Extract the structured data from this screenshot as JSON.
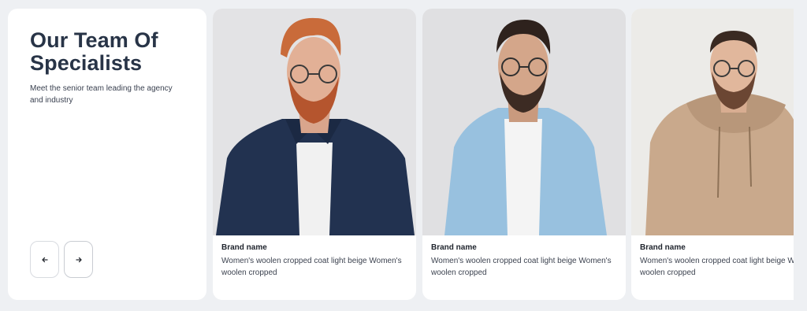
{
  "intro": {
    "title": "Our Team Of Specialists",
    "subtitle": "Meet the senior team leading the agency and industry"
  },
  "navigation": {
    "prev_icon": "arrow-left-icon",
    "next_icon": "arrow-right-icon"
  },
  "cards": [
    {
      "brand": "Brand name",
      "description": "Women's woolen cropped coat light beige Women's woolen cropped"
    },
    {
      "brand": "Brand name",
      "description": "Women's woolen cropped coat light beige Women's woolen cropped"
    },
    {
      "brand": "Brand name",
      "description": "Women's woolen cropped coat light beige Women's woolen cropped"
    }
  ],
  "colors": {
    "page_bg": "#eef0f3",
    "card_bg": "#ffffff",
    "title": "#283447"
  }
}
